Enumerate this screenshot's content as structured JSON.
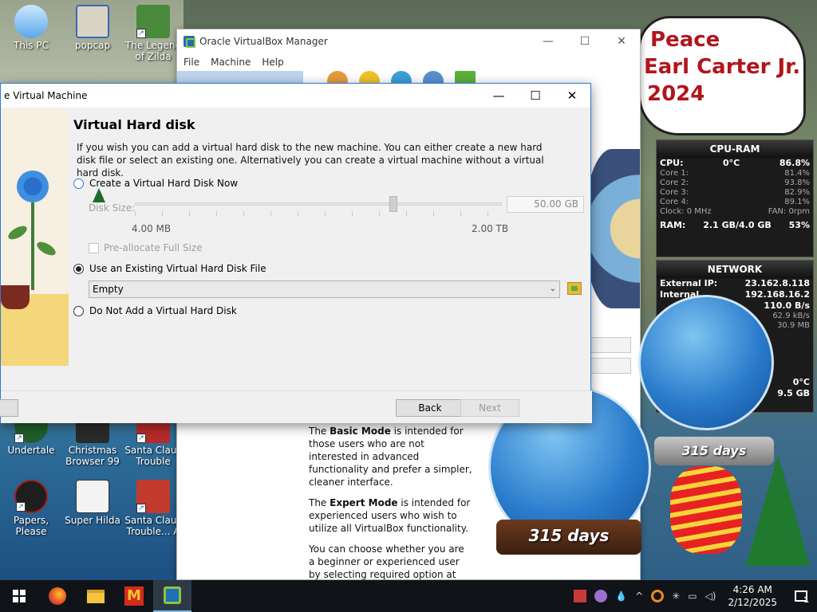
{
  "desktop": {
    "icons": [
      {
        "label": "This PC"
      },
      {
        "label": "popcap"
      },
      {
        "label": "The Legend of Zilda"
      },
      {
        "label": "Undertale"
      },
      {
        "label": "Christmas Browser 99"
      },
      {
        "label": "Santa Claus Trouble"
      },
      {
        "label": "Papers, Please"
      },
      {
        "label": "Super Hilda"
      },
      {
        "label": "Santa Claus Trouble... A"
      }
    ]
  },
  "manager": {
    "title": "Oracle VirtualBox Manager",
    "menu": [
      "File",
      "Machine",
      "Help"
    ],
    "info": {
      "p1_bold": "Basic Mode",
      "p1_pre": "The ",
      "p1_post": " is intended for those users who are not interested in advanced functionality and prefer a simpler, cleaner interface.",
      "p2_pre": "The ",
      "p2_bold": "Expert Mode",
      "p2_post": " is intended for experienced users who wish to utilize all VirtualBox functionality.",
      "p3": "You can choose whether you are a beginner or experienced user by selecting required option at the right. This choice can always be changed in Global Preferences or Machine Settings window."
    }
  },
  "dialog": {
    "title": "e Virtual Machine",
    "heading": "Virtual Hard disk",
    "description": "If you wish you can add a virtual hard disk to the new machine. You can either create a new hard disk file or select an existing one. Alternatively you can create a virtual machine without a virtual hard disk.",
    "option_create": "Create a Virtual Hard Disk Now",
    "disk_size_label": "Disk Size:",
    "disk_size_value": "50.00 GB",
    "slider_min": "4.00 MB",
    "slider_max": "2.00 TB",
    "preallocate": "Pre-allocate Full Size",
    "option_existing": "Use an Existing Virtual Hard Disk File",
    "existing_value": "Empty",
    "option_none": "Do Not Add a Virtual Hard Disk",
    "back": "Back",
    "next": "Next",
    "selected_option": "existing"
  },
  "widgets": {
    "bubble": [
      "Peace",
      "Earl Carter Jr.",
      "2024"
    ],
    "cpu": {
      "title": "CPU-RAM",
      "cpu_label": "CPU:",
      "cpu_temp": "0°C",
      "cpu_value": "86.8%",
      "cores": [
        {
          "label": "Core 1:",
          "value": "81.4%"
        },
        {
          "label": "Core 2:",
          "value": "93.8%"
        },
        {
          "label": "Core 3:",
          "value": "82.9%"
        },
        {
          "label": "Core 4:",
          "value": "89.1%"
        }
      ],
      "clock": "Clock: 0 MHz",
      "fan": "FAN: 0rpm",
      "ram_label": "RAM:",
      "ram_value": "2.1 GB/4.0 GB",
      "ram_pct": "53%"
    },
    "network": {
      "title": "NETWORK",
      "external_label": "External IP:",
      "external_value": "23.162.8.118",
      "internal_label": "Internal",
      "internal_value": "192.168.16.2",
      "rate1": "110.0 B/s",
      "rate2": "62.9 kB/s",
      "rate3": "30.9 MB"
    },
    "temp_fragment": "0°C",
    "size_fragment": "9.5 GB",
    "globe_days_1": "315 days",
    "globe_days_2": "315 days"
  },
  "taskbar": {
    "time": "4:26 AM",
    "date": "2/12/2025",
    "notifications": "1"
  },
  "colors": {
    "accent": "#2a7ad9",
    "bubble_text": "#b3141b",
    "taskbar": "#101418"
  }
}
